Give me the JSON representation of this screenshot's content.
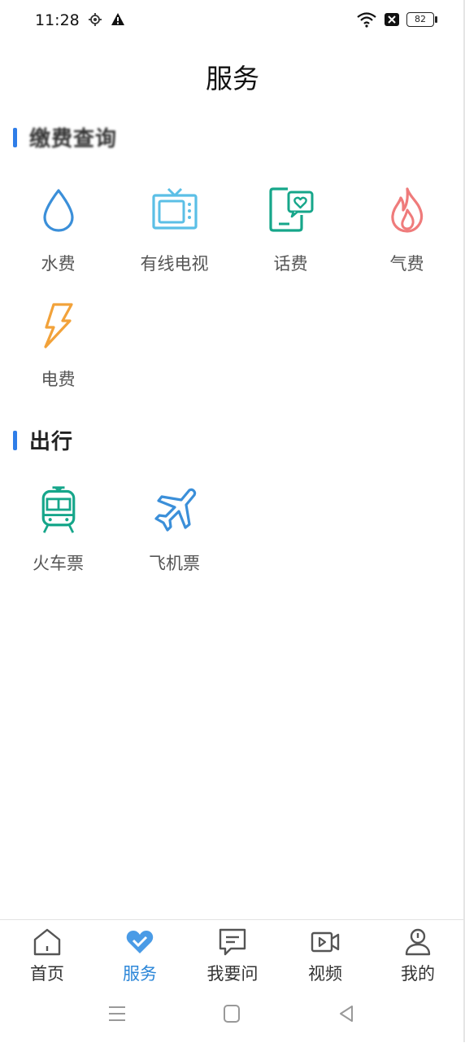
{
  "status": {
    "time": "11:28",
    "battery": "82"
  },
  "header": {
    "title": "服务"
  },
  "sections": [
    {
      "title": "缴费查询",
      "items": [
        {
          "label": "水费",
          "icon": "water-drop-icon",
          "color": "#3b8fd9"
        },
        {
          "label": "有线电视",
          "icon": "tv-icon",
          "color": "#5bbfe6"
        },
        {
          "label": "话费",
          "icon": "phone-bill-icon",
          "color": "#16a68a"
        },
        {
          "label": "气费",
          "icon": "flame-icon",
          "color": "#ef7b7b"
        },
        {
          "label": "电费",
          "icon": "lightning-icon",
          "color": "#f2a23a"
        }
      ]
    },
    {
      "title": "出行",
      "items": [
        {
          "label": "火车票",
          "icon": "train-icon",
          "color": "#16a68a"
        },
        {
          "label": "飞机票",
          "icon": "airplane-icon",
          "color": "#3b8fd9"
        }
      ]
    }
  ],
  "tabbar": {
    "active_color": "#2b86d8",
    "items": [
      {
        "label": "首页",
        "icon": "home-icon"
      },
      {
        "label": "服务",
        "icon": "heart-icon",
        "active": true
      },
      {
        "label": "我要问",
        "icon": "chat-icon"
      },
      {
        "label": "视频",
        "icon": "video-icon"
      },
      {
        "label": "我的",
        "icon": "profile-icon"
      }
    ]
  },
  "accent": "#2f7ee8"
}
